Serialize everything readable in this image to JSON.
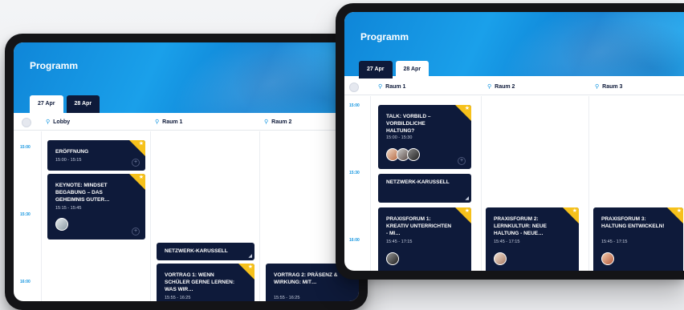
{
  "colors": {
    "accent": "#1596e0",
    "session_bg": "#0e1a3a",
    "favorite": "#f6c11b",
    "header_blue": "#1aa0ea"
  },
  "left_tablet": {
    "app_title": "Programm",
    "tabs": [
      {
        "label": "27 Apr",
        "active": true
      },
      {
        "label": "28 Apr",
        "active": false
      }
    ],
    "rooms": [
      "Lobby",
      "Raum 1",
      "Raum 2"
    ],
    "times": [
      "15:00",
      "15:30",
      "16:00"
    ],
    "sessions": {
      "eroeffnung": {
        "title": "Eröffnung",
        "time": "15:00 - 15:15"
      },
      "keynote": {
        "title": "Keynote: Mindset Begabung – das Geheimnis guter…",
        "time": "15:15 - 15:45"
      },
      "netzwerk": {
        "title": "Netzwerk-Karussell"
      },
      "vortrag1": {
        "title": "Vortrag 1: Wenn Schüler gerne lernen: Was wir…",
        "time": "15:55 - 16:25"
      },
      "vortrag2": {
        "title": "Vortrag 2: Präsenz & Wirkung: Mit…",
        "time": "15:55 - 16:25"
      }
    }
  },
  "right_tablet": {
    "app_title": "Programm",
    "tabs": [
      {
        "label": "27 Apr",
        "active": false
      },
      {
        "label": "28 Apr",
        "active": true
      }
    ],
    "rooms": [
      "Raum 1",
      "Raum 2",
      "Raum 3"
    ],
    "times": [
      "15:00",
      "15:30",
      "16:00"
    ],
    "sessions": {
      "talk": {
        "title": "Talk: Vorbild – vorbildliche Haltung?",
        "time": "15:00 - 15:30"
      },
      "netzwerk": {
        "title": "Netzwerk-Karussell"
      },
      "forum1": {
        "title": "Praxisforum 1: Kreativ unterrichten - Mi…",
        "time": "15:45 - 17:15"
      },
      "forum2": {
        "title": "Praxisforum 2: Lernkultur: Neue Haltung - Neue…",
        "time": "15:45 - 17:15"
      },
      "forum3": {
        "title": "Praxisforum 3: Haltung entwickeln!",
        "time": "15:45 - 17:15"
      }
    }
  },
  "icons": {
    "pin": "location-pin-icon",
    "star": "star-icon",
    "plus": "plus-icon"
  }
}
